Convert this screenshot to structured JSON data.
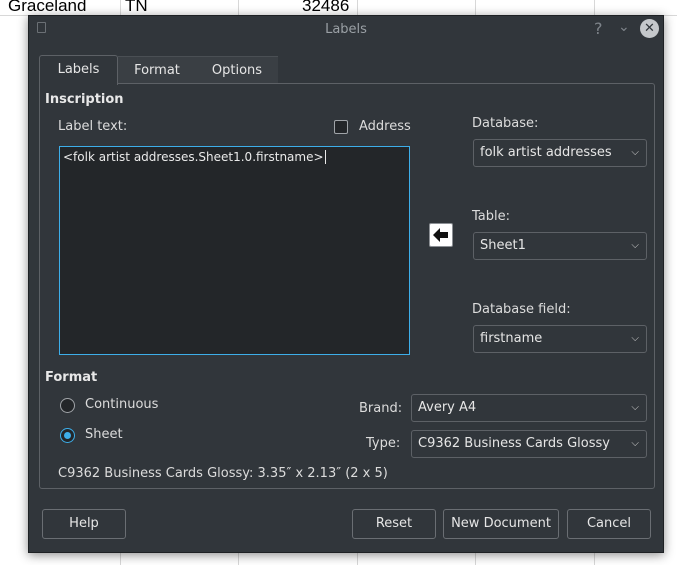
{
  "background": {
    "cells": [
      "Graceland",
      "TN",
      "32486"
    ]
  },
  "window": {
    "title": "Labels"
  },
  "tabs": [
    {
      "label": "Labels",
      "active": true
    },
    {
      "label": "Format",
      "active": false
    },
    {
      "label": "Options",
      "active": false
    }
  ],
  "inscription": {
    "heading": "Inscription",
    "label_text_caption": "Label text:",
    "address_label": "Address",
    "address_checked": false,
    "label_text_value": "<folk artist addresses.Sheet1.0.firstname>"
  },
  "database": {
    "caption": "Database:",
    "value": "folk artist addresses"
  },
  "table": {
    "caption": "Table:",
    "value": "Sheet1"
  },
  "database_field": {
    "caption": "Database field:",
    "value": "firstname"
  },
  "format": {
    "heading": "Format",
    "continuous_label": "Continuous",
    "sheet_label": "Sheet",
    "selected": "Sheet",
    "brand_caption": "Brand:",
    "brand_value": "Avery A4",
    "type_caption": "Type:",
    "type_value": "C9362 Business Cards Glossy",
    "description": "C9362 Business Cards Glossy: 3.35″ x 2.13″ (2 x 5)"
  },
  "buttons": {
    "help": "Help",
    "reset": "Reset",
    "new_document": "New Document",
    "cancel": "Cancel"
  },
  "icons": {
    "help": "question-mark-icon",
    "minimize": "chevron-down-icon",
    "close": "close-icon",
    "insert": "arrow-left-icon",
    "dropdown": "chevron-down-icon"
  },
  "colors": {
    "dialog_bg": "#31363b",
    "accent": "#3daee9"
  }
}
